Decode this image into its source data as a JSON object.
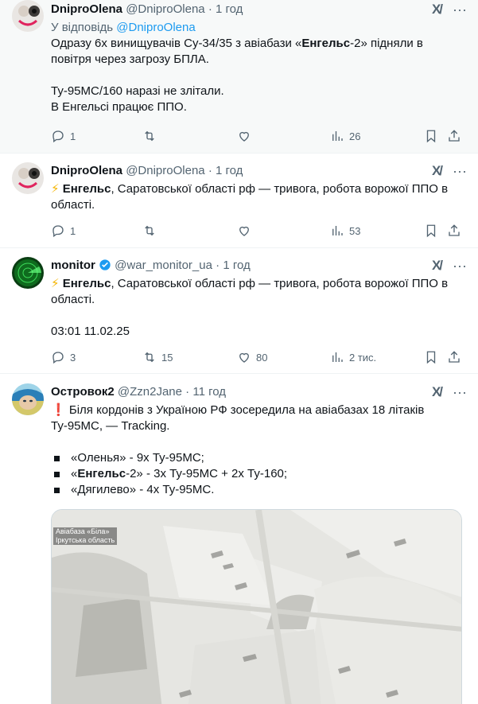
{
  "tweets": [
    {
      "name": "DniproOlena",
      "handle": "@DniproOlena",
      "dot": "·",
      "time": "1 год",
      "replying_prefix": "У відповідь",
      "replying_to": "@DniproOlena",
      "text_1_a": "Одразу 6х винищувачів Су-34/35 з авіабази «",
      "text_1_b": "Енгельс",
      "text_1_c": "-2» підняли в повітря через загрозу БПЛА.",
      "text_2": "Ту-95МС/160 наразі не злітали.",
      "text_3": "В Енгельсі працює ППО.",
      "replies": "1",
      "reposts": "",
      "likes": "",
      "views": "26"
    },
    {
      "name": "DniproOlena",
      "handle": "@DniproOlena",
      "dot": "·",
      "time": "1 год",
      "emoji": "⚡",
      "text_bold": "Енгельс",
      "text_rest": ", Саратовської області рф — тривога, робота ворожої ППО в області.",
      "replies": "1",
      "reposts": "",
      "likes": "",
      "views": "53"
    },
    {
      "name": "monitor",
      "handle": "@war_monitor_ua",
      "dot": "·",
      "time": "1 год",
      "emoji": "⚡",
      "text_bold": "Енгельс",
      "text_rest": ", Саратовської області рф — тривога, робота ворожої ППО в області.",
      "timestamp": "03:01 11.02.25",
      "replies": "3",
      "reposts": "15",
      "likes": "80",
      "views": "2 тис."
    },
    {
      "name": "Островок2",
      "handle": "@Zzn2Jane",
      "dot": "·",
      "time": "11 год",
      "emoji": "❗",
      "text_1": "Біля кордонів з Україною РФ зосередила на авіабазах 18 літаків Ту-95МС, — Tracking.",
      "bullet_1": "«Оленья» - 9х Ту-95МС;",
      "bullet_2_a": "«",
      "bullet_2_b": "Енгельс",
      "bullet_2_c": "-2» - 3х Ту-95МС + 2х Ту-160;",
      "bullet_3": "«Дягилево» - 4х Ту-95МС.",
      "media_caption_1": "Авіабаза «Біла»",
      "media_caption_2": "Іркутська область"
    }
  ],
  "colors": {
    "accent": "#1d9bf0",
    "text": "#0f1419",
    "muted": "#536471",
    "verified": "#1d9bf0"
  },
  "icons": [
    "reply-icon",
    "repost-icon",
    "like-icon",
    "views-icon",
    "bookmark-icon",
    "share-icon",
    "grok-icon",
    "more-icon",
    "verified-icon"
  ]
}
